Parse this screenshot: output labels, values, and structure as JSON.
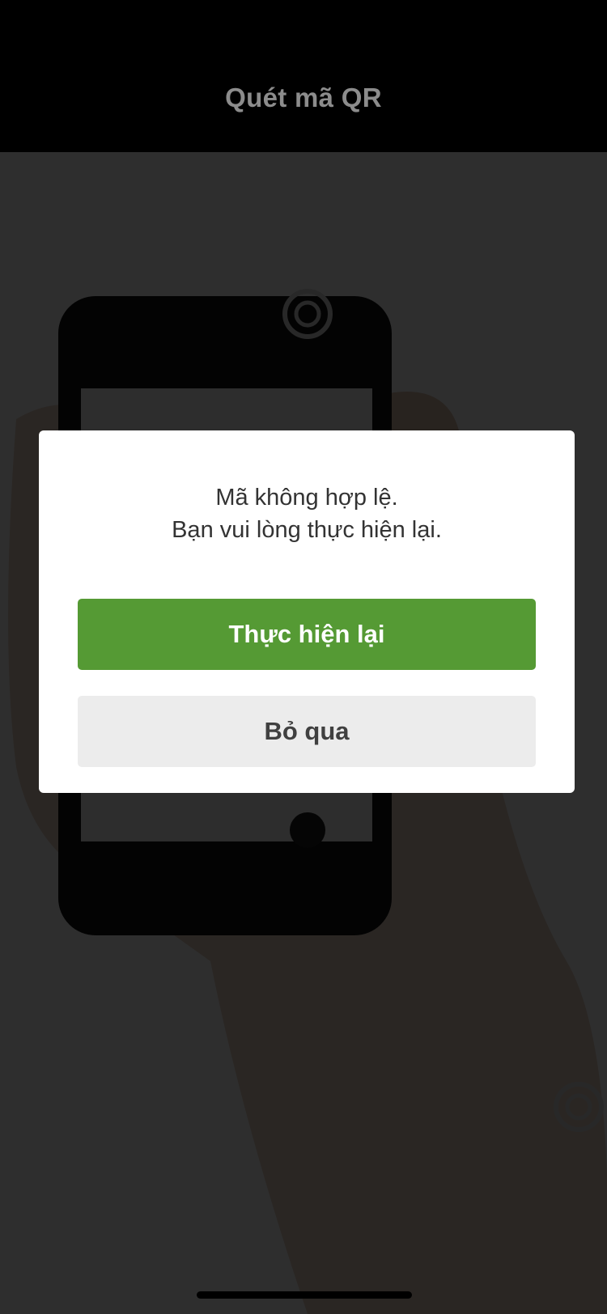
{
  "header": {
    "title": "Quét mã QR"
  },
  "camera_preview": {
    "icon": "camera-preview"
  },
  "dialog": {
    "message_line1": "Mã không hợp lệ.",
    "message_line2": "Bạn vui lòng thực hiện lại.",
    "retry_label": "Thực hiện lại",
    "skip_label": "Bỏ qua"
  },
  "colors": {
    "accent": "#559a34",
    "secondary_button": "#ececec",
    "header_title": "#8c8c8c"
  }
}
